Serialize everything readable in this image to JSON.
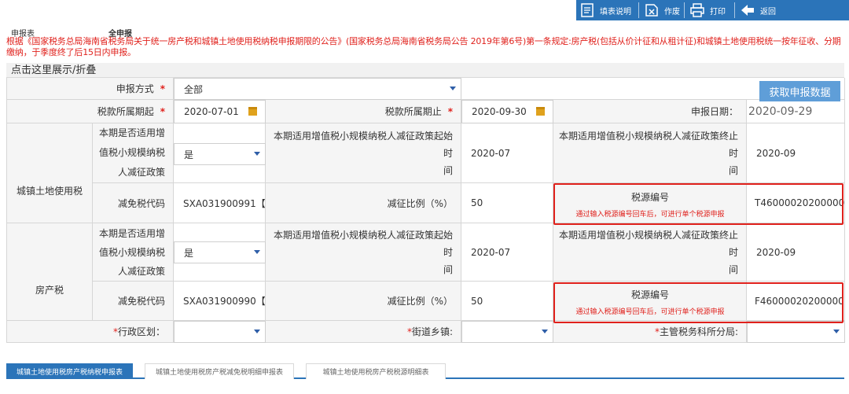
{
  "toolbar": {
    "buttons": [
      {
        "label": "填表说明",
        "icon": "document-icon"
      },
      {
        "label": "作废",
        "icon": "void-icon"
      },
      {
        "label": "打印",
        "icon": "printer-icon"
      },
      {
        "label": "返回",
        "icon": "back-arrow-icon"
      }
    ]
  },
  "header": {
    "form_label": "申报表",
    "form_type": "全申报"
  },
  "notice": "根据《国家税务总局海南省税务局关于统一房产税和城镇土地使用税纳税申报期限的公告》(国家税务总局海南省税务局公告 2019年第6号)第一条规定:房产税(包括从价计征和从租计征)和城镇土地使用税统一按年征收、分期缴纳，于季度终了后15日内申报。",
  "collapse": "点击这里展示/折叠",
  "form": {
    "declare_mode_label": "申报方式",
    "declare_mode_value": "全部",
    "fetch_button": "获取申报数据",
    "period_start_label": "税款所属期起",
    "period_start": "2020-07-01",
    "period_end_label": "税款所属期止",
    "period_end": "2020-09-30",
    "declare_date_label": "申报日期：",
    "declare_date": "2020-09-29",
    "land": {
      "section": "城镇土地使用税",
      "applies_label_1": "本期是否适用增",
      "applies_label_2": "值税小规模纳税",
      "applies_label_3": "人减征政策",
      "applies_value": "是",
      "policy_start_label_1": "本期适用增值税小规模纳税人减征政策起始时",
      "policy_start_label_2": "间",
      "policy_start": "2020-07",
      "policy_end_label_1": "本期适用增值税小规模纳税人减征政策终止时",
      "policy_end_label_2": "间",
      "policy_end": "2020-09",
      "exempt_code_label": "减免税代码",
      "exempt_code": "SXA031900991【I",
      "ratio_label": "减征比例（%）",
      "ratio": "50",
      "tax_source_label": "税源编号",
      "tax_source_hint": "通过输入税源编号回车后，可进行单个税源申报",
      "tax_source": "T46000020200000"
    },
    "property": {
      "section": "房产税",
      "applies_label_1": "本期是否适用增",
      "applies_label_2": "值税小规模纳税",
      "applies_label_3": "人减征政策",
      "applies_value": "是",
      "policy_start_label_1": "本期适用增值税小规模纳税人减征政策起始时",
      "policy_start_label_2": "间",
      "policy_start": "2020-07",
      "policy_end_label_1": "本期适用增值税小规模纳税人减征政策终止时",
      "policy_end_label_2": "间",
      "policy_end": "2020-09",
      "exempt_code_label": "减免税代码",
      "exempt_code": "SXA031900990【I",
      "ratio_label": "减征比例（%）",
      "ratio": "50",
      "tax_source_label": "税源编号",
      "tax_source_hint": "通过输入税源编号回车后，可进行单个税源申报",
      "tax_source": "F46000020200000"
    },
    "admin_region_label": "行政区划：",
    "street_label": "街道乡镇:",
    "tax_office_label": "主管税务科所分局:"
  },
  "tabs": [
    {
      "label": "城镇土地使用税房产税纳税申报表",
      "active": true
    },
    {
      "label": "城镇土地使用税房产税减免税明细申报表",
      "active": false
    },
    {
      "label": "城镇土地使用税房产税税源明细表",
      "active": false
    }
  ],
  "colors": {
    "accent": "#2b74b9",
    "warning": "#e0211c",
    "button": "#5f9ed8"
  }
}
